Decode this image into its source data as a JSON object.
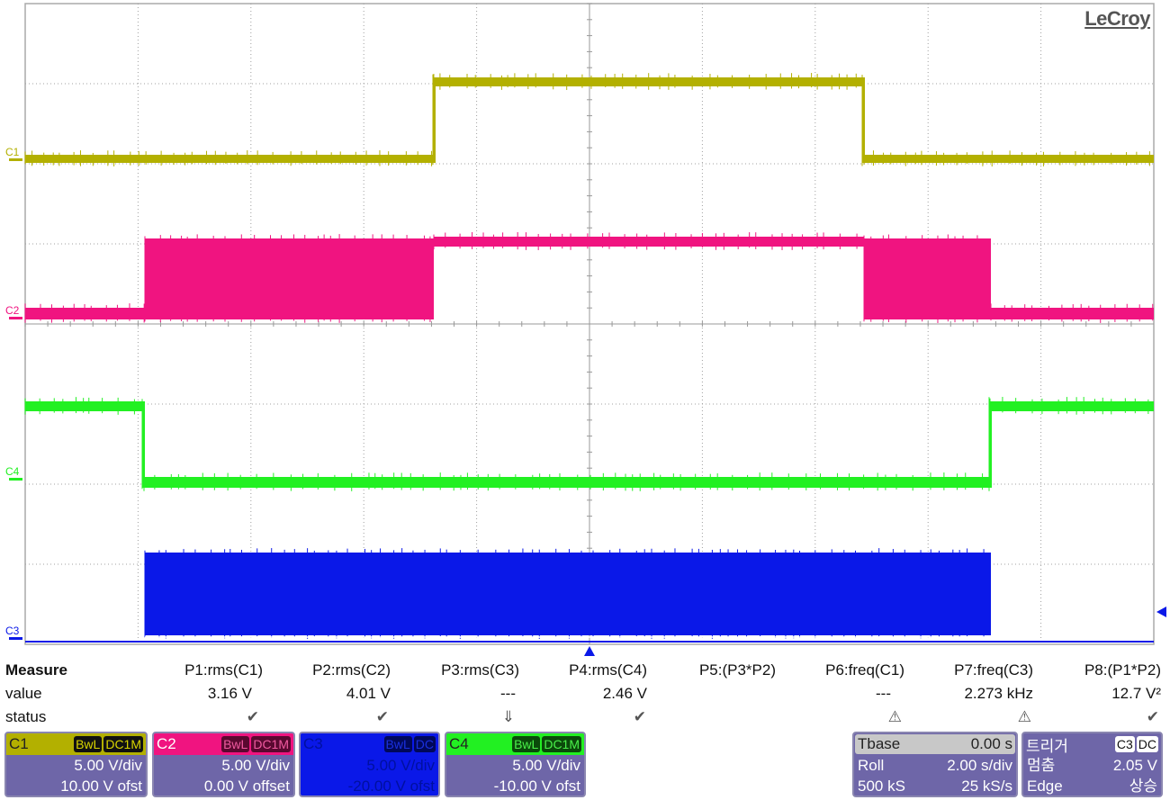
{
  "brand": "LeCroy",
  "colors": {
    "c1": "#b3b000",
    "c2": "#f01480",
    "c3": "#0a18e8",
    "c4": "#22f022",
    "grid": "#a0a0a0",
    "panel": "#6e66a8"
  },
  "channel_markers": [
    "C1",
    "C2",
    "C4",
    "C3"
  ],
  "measure": {
    "title": "Measure",
    "value_label": "value",
    "status_label": "status",
    "params": [
      {
        "name": "P1:rms(C1)",
        "value": "3.16 V",
        "status": "✔"
      },
      {
        "name": "P2:rms(C2)",
        "value": "4.01 V",
        "status": "✔"
      },
      {
        "name": "P3:rms(C3)",
        "value": "---",
        "status": "⇓"
      },
      {
        "name": "P4:rms(C4)",
        "value": "2.46 V",
        "status": "✔"
      },
      {
        "name": "P5:(P3*P2)",
        "value": "",
        "status": ""
      },
      {
        "name": "P6:freq(C1)",
        "value": "---",
        "status": "⚠"
      },
      {
        "name": "P7:freq(C3)",
        "value": "2.273 kHz",
        "status": "⚠"
      },
      {
        "name": "P8:(P1*P2)",
        "value": "12.7 V²",
        "status": "✔"
      }
    ]
  },
  "channels": [
    {
      "name": "C1",
      "bw": "BwL",
      "coupling": "DC1M",
      "vdiv": "5.00 V/div",
      "offset": "10.00 V ofst"
    },
    {
      "name": "C2",
      "bw": "BwL",
      "coupling": "DC1M",
      "vdiv": "5.00 V/div",
      "offset": "0.00 V offset"
    },
    {
      "name": "C3",
      "bw": "BwL",
      "coupling": "DC",
      "vdiv": "5.00 V/div",
      "offset": "-20.00 V ofst"
    },
    {
      "name": "C4",
      "bw": "BwL",
      "coupling": "DC1M",
      "vdiv": "5.00 V/div",
      "offset": "-10.00 V ofst"
    }
  ],
  "timebase": {
    "title": "Tbase",
    "delay": "0.00 s",
    "mode": "Roll",
    "tdiv": "2.00 s/div",
    "samples": "500 kS",
    "rate": "25 kS/s"
  },
  "trigger": {
    "title": "트리거",
    "source": "C3",
    "coupling": "DC",
    "state": "멈춤",
    "level": "2.05 V",
    "type": "Edge",
    "slope": "상승"
  }
}
